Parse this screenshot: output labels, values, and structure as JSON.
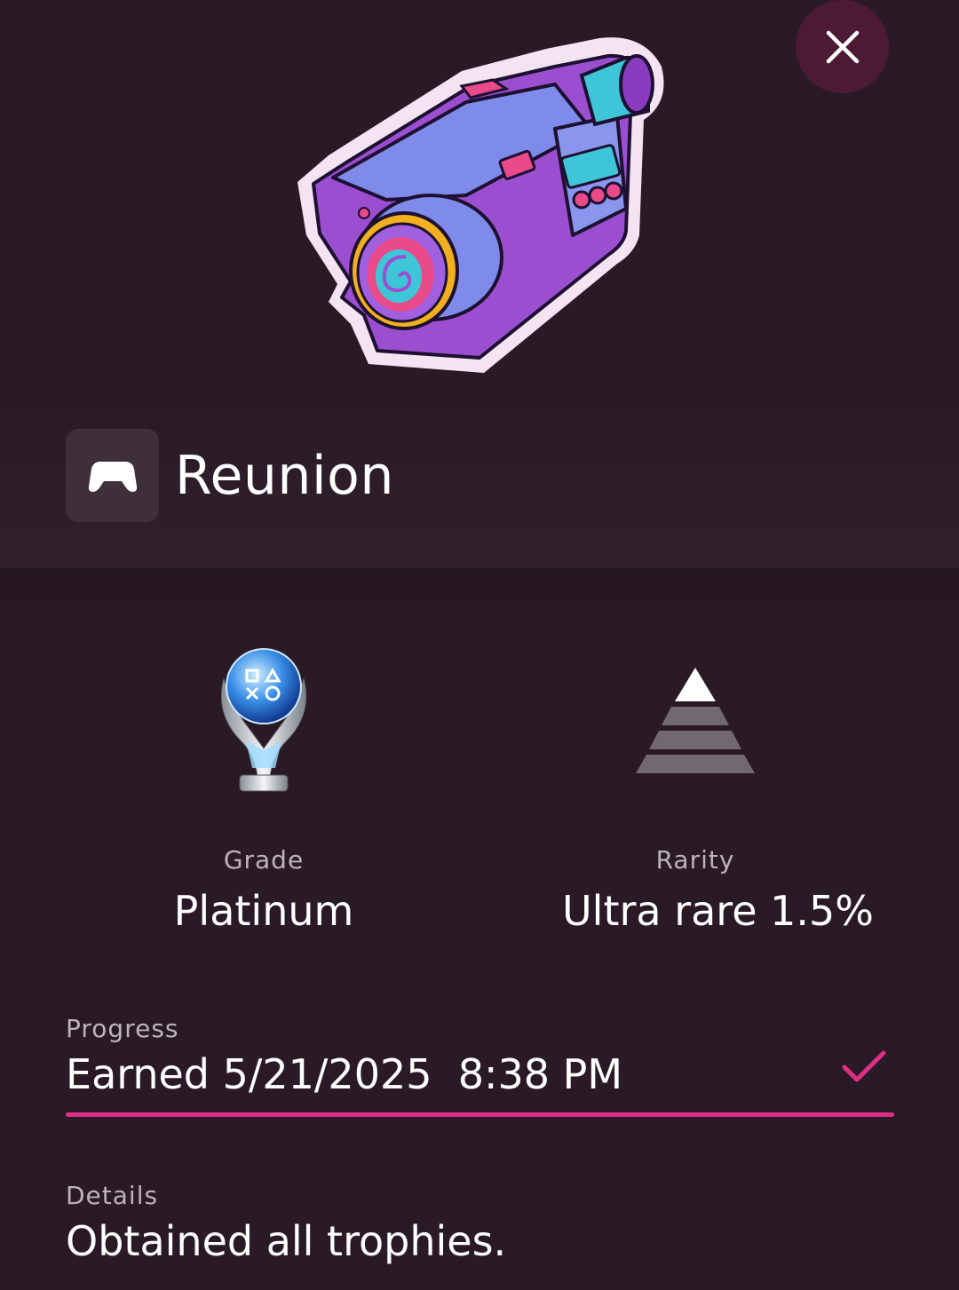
{
  "trophy": {
    "art_icon": "camcorder-trophy-art",
    "name": "Reunion",
    "game_icon": "gamepad-icon"
  },
  "close_icon": "close-icon",
  "grade": {
    "label": "Grade",
    "value": "Platinum",
    "icon": "platinum-trophy-icon"
  },
  "rarity": {
    "label": "Rarity",
    "value": "Ultra rare 1.5%",
    "icon": "rarity-pyramid-icon",
    "tiers_highlighted": 1,
    "tiers_total": 4
  },
  "progress": {
    "label": "Progress",
    "value": "Earned 5/21/2025  8:38 PM",
    "complete_icon": "checkmark-icon",
    "fraction": 1.0
  },
  "details": {
    "label": "Details",
    "value": "Obtained all trophies."
  },
  "colors": {
    "background": "#2a1a25",
    "accent": "#df2f87",
    "close_button_bg": "#4d1a35",
    "label_text": "#bdb3b9"
  }
}
